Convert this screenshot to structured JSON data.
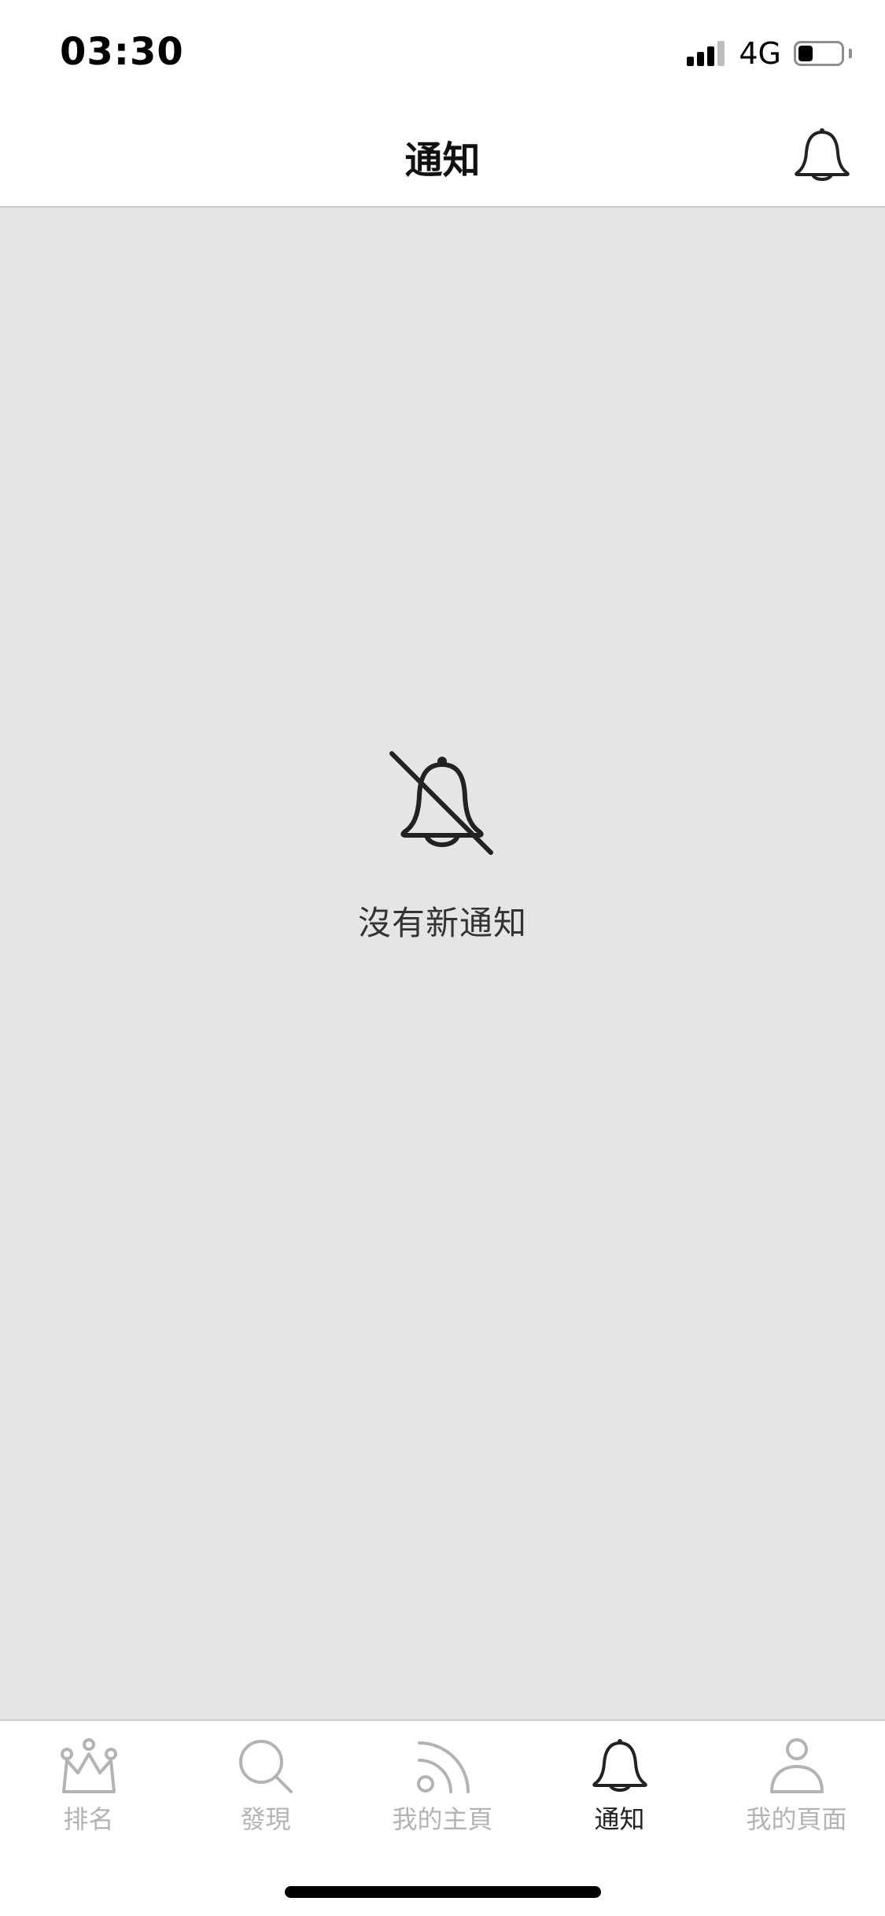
{
  "status_bar": {
    "time": "03:30",
    "network": "4G",
    "signal_bars_filled": 3,
    "signal_bars_total": 4,
    "battery_level": 0.35
  },
  "header": {
    "title": "通知",
    "action_icon": "bell-icon"
  },
  "empty_state": {
    "icon": "bell-off-icon",
    "message": "沒有新通知"
  },
  "tab_bar": {
    "active_tab": "notifications",
    "tabs": [
      {
        "key": "ranking",
        "label": "排名",
        "icon": "crown-icon"
      },
      {
        "key": "discover",
        "label": "發現",
        "icon": "search-icon"
      },
      {
        "key": "my_home",
        "label": "我的主頁",
        "icon": "feed-icon"
      },
      {
        "key": "notifications",
        "label": "通知",
        "icon": "bell-icon"
      },
      {
        "key": "my_page",
        "label": "我的頁面",
        "icon": "person-icon"
      }
    ]
  },
  "colors": {
    "content_background": "#e5e5e5",
    "active_tab": "#222222",
    "inactive_tab": "#b3b3b3"
  }
}
